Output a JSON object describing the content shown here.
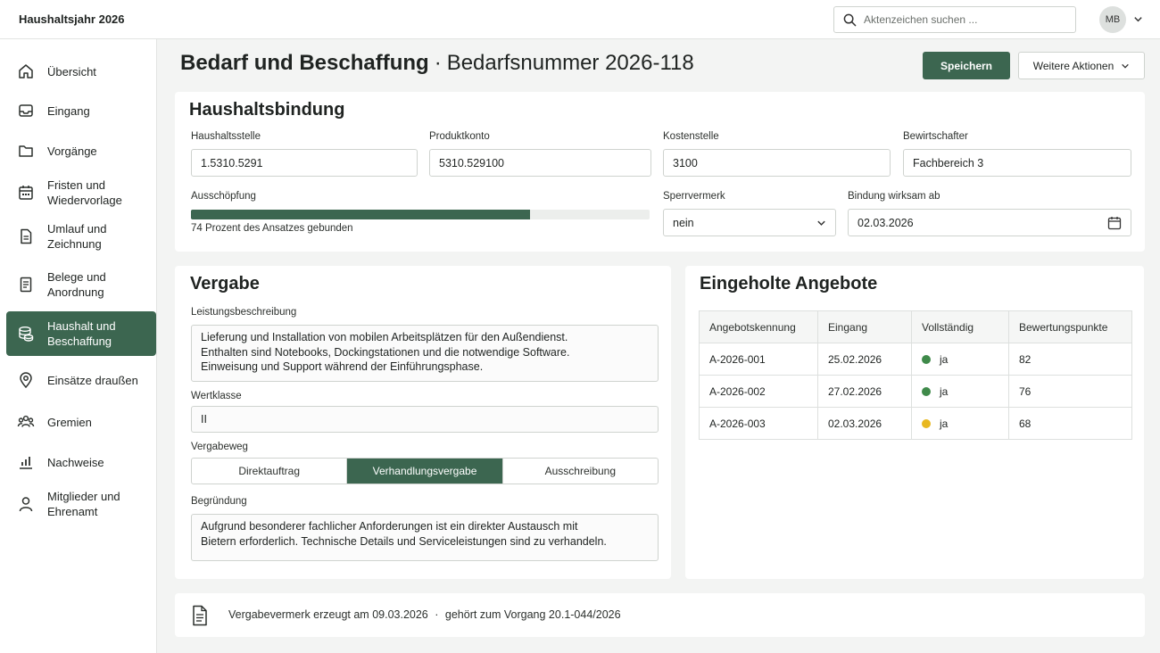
{
  "app": {
    "title": "Haushaltsjahr 2026"
  },
  "search": {
    "placeholder": "Aktenzeichen suchen ..."
  },
  "user": {
    "initials": "MB"
  },
  "sidebar": {
    "items": [
      {
        "label": "Übersicht",
        "icon": "home-icon"
      },
      {
        "label": "Eingang",
        "icon": "inbox-icon"
      },
      {
        "label": "Vorgänge",
        "icon": "folder-icon"
      },
      {
        "label": "Fristen und Wiedervorlage",
        "icon": "calendar-icon"
      },
      {
        "label": "Umlauf und Zeichnung",
        "icon": "document-icon"
      },
      {
        "label": "Belege und Anordnung",
        "icon": "receipt-icon"
      },
      {
        "label": "Haushalt und Beschaffung",
        "icon": "coins-icon",
        "active": true
      },
      {
        "label": "Einsätze draußen",
        "icon": "map-pin-icon"
      },
      {
        "label": "Gremien",
        "icon": "group-icon"
      },
      {
        "label": "Nachweise",
        "icon": "bar-chart-icon"
      },
      {
        "label": "Mitglieder und Ehrenamt",
        "icon": "user-icon"
      }
    ]
  },
  "header": {
    "title": "Bedarf und Beschaffung",
    "separator": "·",
    "subtitle": "Bedarfsnummer 2026-118",
    "save_label": "Speichern",
    "more_label": "Weitere Aktionen"
  },
  "budget": {
    "title": "Haushaltsbindung",
    "haushaltsstelle": {
      "label": "Haushaltsstelle",
      "value": "1.5310.5291"
    },
    "produktkonto": {
      "label": "Produktkonto",
      "value": "5310.529100"
    },
    "kostenstelle": {
      "label": "Kostenstelle",
      "value": "3100"
    },
    "bewirtschafter": {
      "label": "Bewirtschafter",
      "value": "Fachbereich 3"
    },
    "ausschoepfung": {
      "label": "Ausschöpfung",
      "percent": 74,
      "text": "74 Prozent des Ansatzes gebunden"
    },
    "sperrvermerk": {
      "label": "Sperrvermerk",
      "value": "nein"
    },
    "bindung": {
      "label": "Bindung wirksam ab",
      "value": "02.03.2026"
    }
  },
  "award": {
    "title": "Vergabe",
    "description": {
      "label": "Leistungsbeschreibung",
      "lines": [
        "Lieferung und Installation von mobilen Arbeitsplätzen für den Außendienst.",
        "Enthalten sind Notebooks, Dockingstationen und die notwendige Software.",
        "Einweisung und Support während der Einführungsphase."
      ]
    },
    "wertklasse": {
      "label": "Wertklasse",
      "value": "II"
    },
    "vergabeweg": {
      "label": "Vergabeweg",
      "options": [
        "Direktauftrag",
        "Verhandlungsvergabe",
        "Ausschreibung"
      ],
      "selected": "Verhandlungsvergabe"
    },
    "begruendung": {
      "label": "Begründung",
      "lines": [
        "Aufgrund besonderer fachlicher Anforderungen ist ein direkter Austausch mit",
        "Bietern erforderlich. Technische Details und Serviceleistungen sind zu verhandeln."
      ]
    }
  },
  "offers": {
    "title": "Eingeholte Angebote",
    "columns": [
      "Angebotskennung",
      "Eingang",
      "Vollständig",
      "Bewertungspunkte"
    ],
    "rows": [
      {
        "id": "A-2026-001",
        "date": "25.02.2026",
        "complete": "ja",
        "status_color": "#3f8a4a",
        "points": "82"
      },
      {
        "id": "A-2026-002",
        "date": "27.02.2026",
        "complete": "ja",
        "status_color": "#3f8a4a",
        "points": "76"
      },
      {
        "id": "A-2026-003",
        "date": "02.03.2026",
        "complete": "ja",
        "status_color": "#e8b820",
        "points": "68"
      }
    ]
  },
  "footer": {
    "text": "Vergabevermerk erzeugt am 09.03.2026",
    "separator": "·",
    "link": "gehört zum Vorgang 20.1-044/2026"
  },
  "colors": {
    "accent": "#3c6650",
    "ok": "#3f8a4a",
    "warn": "#e8b820"
  }
}
